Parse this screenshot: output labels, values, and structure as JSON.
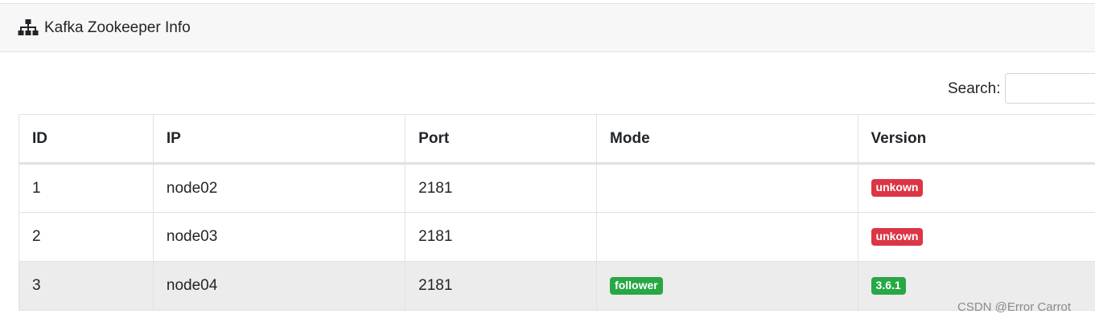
{
  "header": {
    "icon": "sitemap-icon",
    "title": "Kafka Zookeeper Info"
  },
  "search": {
    "label": "Search:",
    "value": "",
    "placeholder": ""
  },
  "table": {
    "columns": [
      "ID",
      "IP",
      "Port",
      "Mode",
      "Version"
    ],
    "rows": [
      {
        "id": "1",
        "ip": "node02",
        "port": "2181",
        "mode": "",
        "version": "unkown",
        "version_status": "danger"
      },
      {
        "id": "2",
        "ip": "node03",
        "port": "2181",
        "mode": "",
        "version": "unkown",
        "version_status": "danger"
      },
      {
        "id": "3",
        "ip": "node04",
        "port": "2181",
        "mode": "follower",
        "mode_status": "success",
        "version": "3.6.1",
        "version_status": "success"
      }
    ]
  },
  "colors": {
    "danger": "#dc3545",
    "success": "#28a745"
  },
  "watermark": "CSDN @Error Carrot"
}
